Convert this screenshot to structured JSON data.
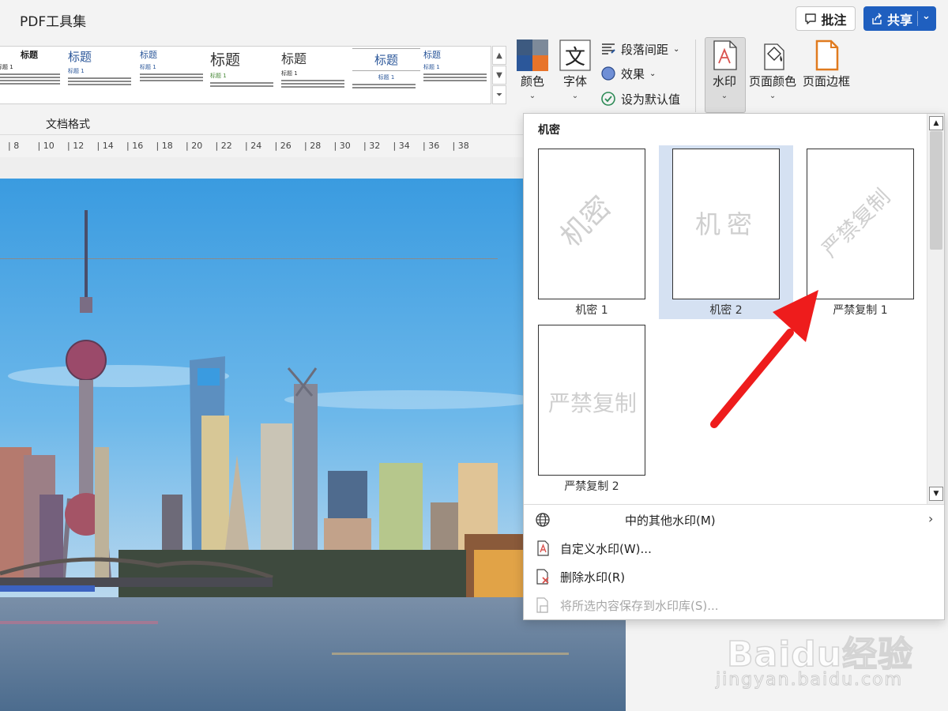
{
  "menu": {
    "items": [
      "PDF工具集"
    ]
  },
  "top_actions": {
    "comment": "批注",
    "share": "共享"
  },
  "ribbon": {
    "styles": [
      {
        "title": "标题",
        "sub": "标题 1",
        "size": "11"
      },
      {
        "title": "标题",
        "sub": "标题 1",
        "size": "15"
      },
      {
        "title": "标题",
        "sub": "标题 1",
        "size": "11"
      },
      {
        "title": "标题",
        "sub": "标题 1",
        "size": "19"
      },
      {
        "title": "标题",
        "sub": "标题 1",
        "size": "16"
      },
      {
        "title": "标题",
        "sub": "标题 1",
        "size": "15"
      },
      {
        "title": "标题",
        "sub": "标题 1",
        "size": "11"
      }
    ],
    "group_label": "文档格式",
    "colors_label": "颜色",
    "fonts_label": "字体",
    "paragraph_spacing": "段落间距",
    "effects": "效果",
    "set_default": "设为默认值",
    "watermark": "水印",
    "page_color": "页面颜色",
    "page_border": "页面边框",
    "accent_colors": [
      "#2b579a",
      "#e8742a",
      "#3d5a80",
      "#f08a3a"
    ]
  },
  "ruler": {
    "ticks": [
      "8",
      "10",
      "12",
      "14",
      "16",
      "18",
      "20",
      "22",
      "24",
      "26",
      "28",
      "30",
      "32",
      "34",
      "36",
      "38"
    ]
  },
  "dropdown": {
    "section": "机密",
    "items": [
      {
        "label": "机密 1",
        "text": "机密",
        "style": "diagonal",
        "selected": false
      },
      {
        "label": "机密 2",
        "text": "机密",
        "style": "horizontal",
        "selected": true
      },
      {
        "label": "严禁复制 1",
        "text": "严禁复制",
        "style": "diagonal",
        "selected": false
      },
      {
        "label": "严禁复制 2",
        "text": "严禁复制",
        "style": "horizontal",
        "selected": false
      }
    ],
    "more": "中的其他水印(M)",
    "custom": "自定义水印(W)...",
    "remove": "删除水印(R)",
    "save": "将所选内容保存到水印库(S)..."
  },
  "baidu": {
    "logo": "Baidu经验",
    "url": "jingyan.baidu.com"
  }
}
